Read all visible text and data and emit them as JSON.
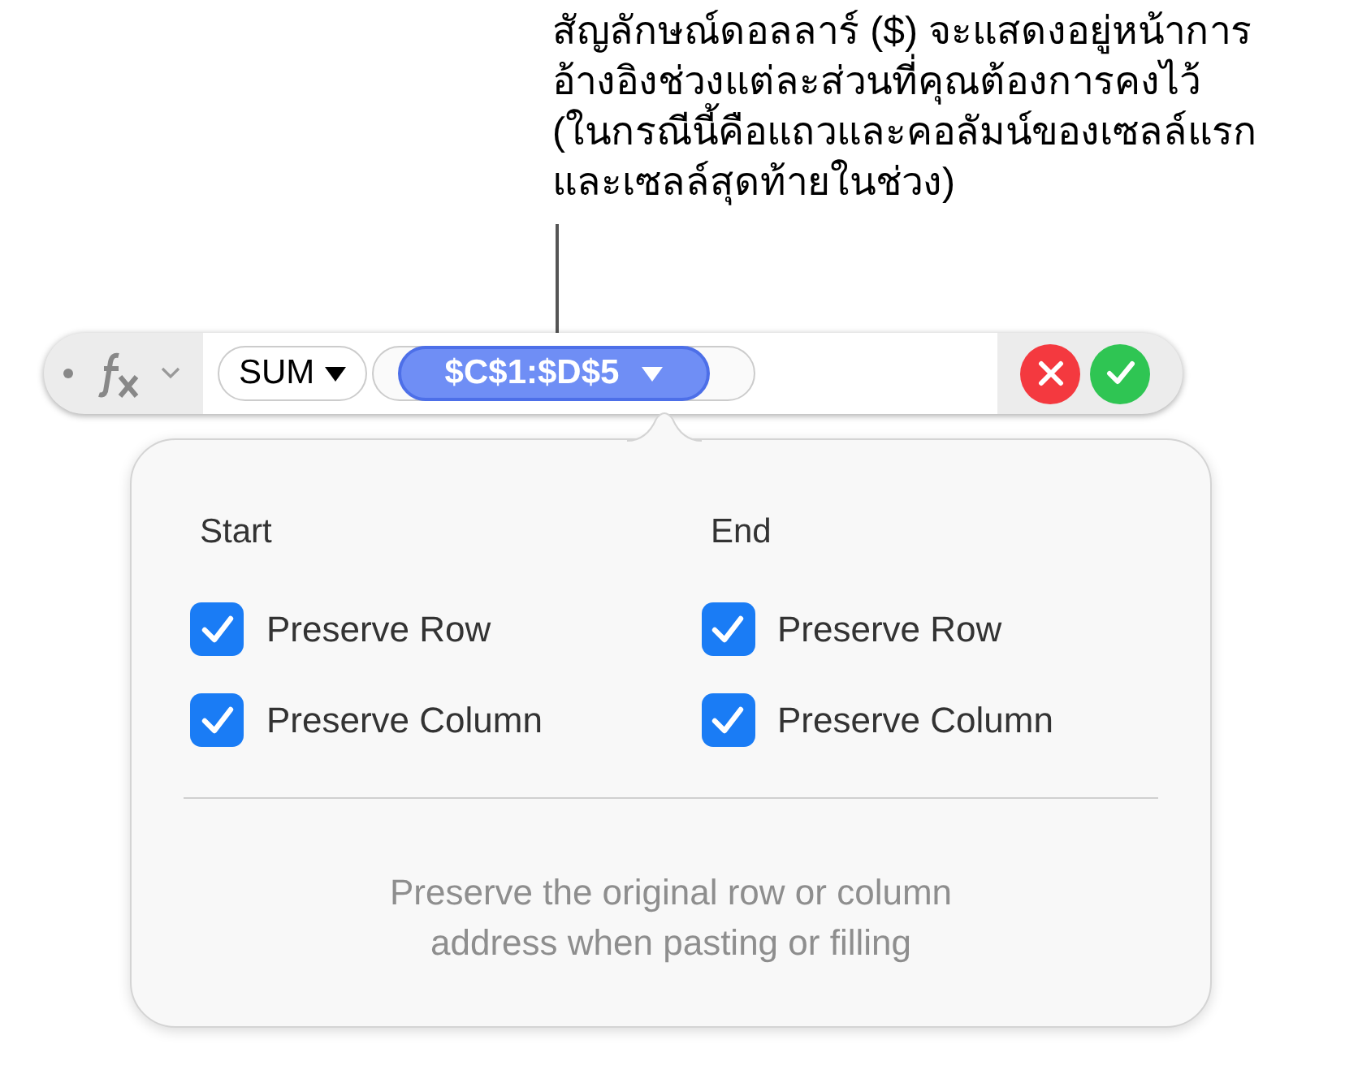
{
  "callout": {
    "lines": [
      "สัญลักษณ์ดอลลาร์ ($) จะแสดงอยู่หน้าการ",
      "อ้างอิงช่วงแต่ละส่วนที่คุณต้องการคงไว้",
      "(ในกรณีนี้คือแถวและคอลัมน์ของเซลล์แรก",
      "และเซลล์สุดท้ายในช่วง)"
    ]
  },
  "formula_bar": {
    "function": "SUM",
    "reference": "$C$1:$D$5"
  },
  "popover": {
    "groups": [
      {
        "title": "Start",
        "options": [
          {
            "label": "Preserve Row",
            "checked": true
          },
          {
            "label": "Preserve Column",
            "checked": true
          }
        ]
      },
      {
        "title": "End",
        "options": [
          {
            "label": "Preserve Row",
            "checked": true
          },
          {
            "label": "Preserve Column",
            "checked": true
          }
        ]
      }
    ],
    "hint": "Preserve the original row or column address when pasting or filling"
  }
}
